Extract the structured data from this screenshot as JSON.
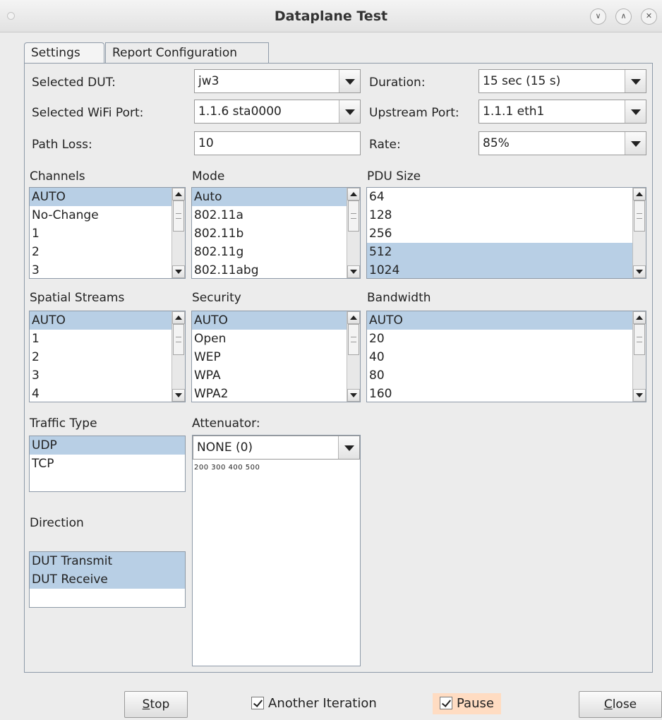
{
  "window": {
    "title": "Dataplane Test"
  },
  "tabs": [
    {
      "label": "Settings"
    },
    {
      "label": "Report Configuration"
    }
  ],
  "form": {
    "selected_dut": {
      "label": "Selected DUT:",
      "value": "jw3"
    },
    "selected_wifi_port": {
      "label": "Selected WiFi Port:",
      "value": "1.1.6 sta0000"
    },
    "path_loss": {
      "label": "Path Loss:",
      "value": "10"
    },
    "duration": {
      "label": "Duration:",
      "value": "15 sec (15 s)"
    },
    "upstream_port": {
      "label": "Upstream Port:",
      "value": "1.1.1 eth1"
    },
    "rate": {
      "label": "Rate:",
      "value": "85%"
    }
  },
  "channels": {
    "label": "Channels",
    "items": [
      "AUTO",
      "No-Change",
      "1",
      "2",
      "3"
    ],
    "selected": [
      "AUTO"
    ]
  },
  "mode": {
    "label": "Mode",
    "items": [
      "Auto",
      "802.11a",
      "802.11b",
      "802.11g",
      "802.11abg"
    ],
    "selected": [
      "Auto"
    ]
  },
  "pdu_size": {
    "label": "PDU Size",
    "items": [
      "64",
      "128",
      "256",
      "512",
      "1024"
    ],
    "selected": [
      "512",
      "1024"
    ]
  },
  "spatial_streams": {
    "label": "Spatial Streams",
    "items": [
      "AUTO",
      "1",
      "2",
      "3",
      "4"
    ],
    "selected": [
      "AUTO"
    ]
  },
  "security": {
    "label": "Security",
    "items": [
      "AUTO",
      "Open",
      "WEP",
      "WPA",
      "WPA2"
    ],
    "selected": [
      "AUTO"
    ]
  },
  "bandwidth": {
    "label": "Bandwidth",
    "items": [
      "AUTO",
      "20",
      "40",
      "80",
      "160"
    ],
    "selected": [
      "AUTO"
    ]
  },
  "traffic_type": {
    "label": "Traffic Type",
    "items": [
      "UDP",
      "TCP"
    ],
    "selected": [
      "UDP"
    ]
  },
  "direction": {
    "label": "Direction",
    "items": [
      "DUT Transmit",
      "DUT Receive"
    ],
    "selected": [
      "DUT Transmit",
      "DUT Receive"
    ]
  },
  "attenuator": {
    "label": "Attenuator:",
    "value": "NONE (0)",
    "scale": "200 300 400  500"
  },
  "buttons": {
    "stop": {
      "prefix": "S",
      "rest": "top"
    },
    "close": {
      "prefix": "C",
      "rest": "lose"
    }
  },
  "checkboxes": {
    "another_iteration": {
      "label": "Another Iteration",
      "checked": true
    },
    "pause": {
      "label": "Pause",
      "checked": true
    }
  },
  "colors": {
    "selection": "#b8cfe5",
    "pause_highlight": "#ffdcc2",
    "border": "#8e9aa8"
  }
}
